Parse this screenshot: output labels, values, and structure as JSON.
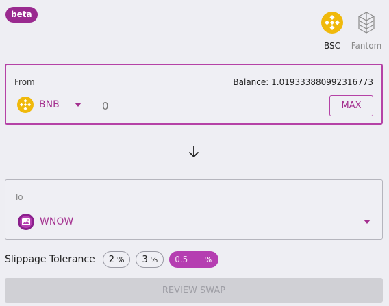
{
  "badge": {
    "label": "beta"
  },
  "networks": [
    {
      "label": "BSC",
      "icon": "bnb-logo-icon",
      "active": true
    },
    {
      "label": "Fantom",
      "icon": "fantom-logo-icon",
      "active": false
    }
  ],
  "from": {
    "label": "From",
    "balance": "Balance: 1.019333880992316773",
    "token": "BNB",
    "amount_placeholder": "0",
    "max_label": "MAX"
  },
  "to": {
    "label": "To",
    "token": "WNOW"
  },
  "slippage": {
    "label": "Slippage Tolerance",
    "options": [
      {
        "value": "2",
        "unit": "%"
      },
      {
        "value": "3",
        "unit": "%"
      }
    ],
    "custom_value": "0.5",
    "custom_unit": "%"
  },
  "review": {
    "label": "REVIEW SWAP"
  },
  "colors": {
    "accent": "#b542a6",
    "token_text": "#a4308f",
    "background": "#eeeef3",
    "bnb_yellow": "#f0b90b"
  }
}
